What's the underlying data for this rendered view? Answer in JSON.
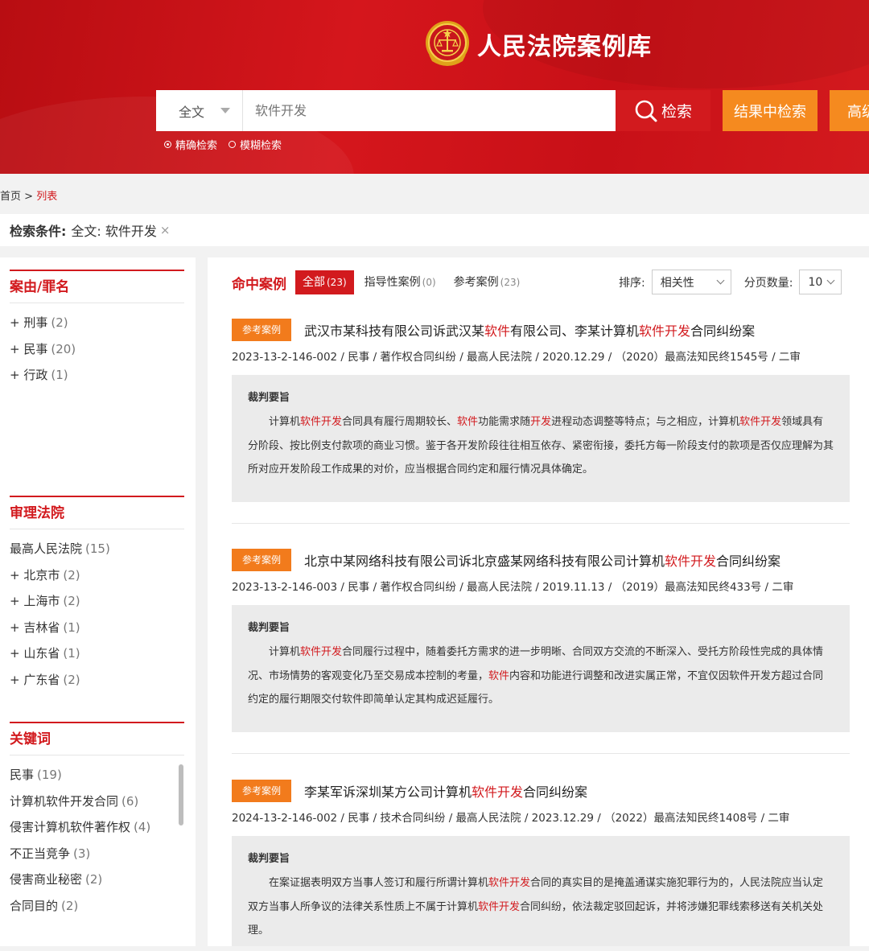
{
  "site": {
    "title": "人民法院案例库"
  },
  "search": {
    "scope": "全文",
    "placeholder": "软件开发",
    "search_label": "检索",
    "refine_label": "结果中检索",
    "advanced_label": "高级检索",
    "modes": [
      "精确检索",
      "模糊检索"
    ]
  },
  "breadcrumb": {
    "home": "首页",
    "sep": ">",
    "current": "列表"
  },
  "conditions": {
    "label": "检索条件:",
    "value": "全文: 软件开发",
    "remove": "×"
  },
  "sidebar": {
    "sections": [
      {
        "title": "案由/罪名",
        "items": [
          {
            "label": "+ 刑事",
            "count": "(2)"
          },
          {
            "label": "+ 民事",
            "count": "(20)"
          },
          {
            "label": "+ 行政",
            "count": "(1)"
          }
        ]
      },
      {
        "title": "审理法院",
        "items": [
          {
            "label": "最高人民法院",
            "count": "(15)"
          },
          {
            "label": "+ 北京市",
            "count": "(2)"
          },
          {
            "label": "+ 上海市",
            "count": "(2)"
          },
          {
            "label": "+ 吉林省",
            "count": "(1)"
          },
          {
            "label": "+ 山东省",
            "count": "(1)"
          },
          {
            "label": "+ 广东省",
            "count": "(2)"
          }
        ]
      },
      {
        "title": "关键词",
        "items": [
          {
            "label": "民事",
            "count": "(19)"
          },
          {
            "label": "计算机软件开发合同",
            "count": "(6)"
          },
          {
            "label": "侵害计算机软件著作权",
            "count": "(4)"
          },
          {
            "label": "不正当竞争",
            "count": "(3)"
          },
          {
            "label": "侵害商业秘密",
            "count": "(2)"
          },
          {
            "label": "合同目的",
            "count": "(2)"
          }
        ]
      }
    ]
  },
  "results": {
    "heading": "命中案例",
    "tabs": [
      {
        "label": "全部",
        "count": "(23)"
      },
      {
        "label": "指导性案例",
        "count": "(0)"
      },
      {
        "label": "参考案例",
        "count": "(23)"
      }
    ],
    "sort_label": "排序:",
    "sort_value": "相关性",
    "page_size_label": "分页数量:",
    "page_size_value": "10",
    "cases": [
      {
        "tag": "参考案例",
        "title": [
          {
            "t": "武汉市某科技有限公司诉武汉某",
            "h": false
          },
          {
            "t": "软件",
            "h": true
          },
          {
            "t": "有限公司、李某计算机",
            "h": false
          },
          {
            "t": "软件开发",
            "h": true
          },
          {
            "t": "合同纠纷案",
            "h": false
          }
        ],
        "meta": "2023-13-2-146-002 / 民事 / 著作权合同纠纷 / 最高人民法院 / 2020.12.29 / （2020）最高法知民终1545号 / 二审",
        "summary_title": "裁判要旨",
        "summary": [
          {
            "t": "计算机",
            "h": false
          },
          {
            "t": "软件开发",
            "h": true
          },
          {
            "t": "合同具有履行周期较长、",
            "h": false
          },
          {
            "t": "软件",
            "h": true
          },
          {
            "t": "功能需求随",
            "h": false
          },
          {
            "t": "开发",
            "h": true
          },
          {
            "t": "进程动态调整等特点；与之相应，计算机",
            "h": false
          },
          {
            "t": "软件开发",
            "h": true
          },
          {
            "t": "领域具有分阶段、按比例支付款项的商业习惯。鉴于各开发阶段往往相互依存、紧密衔接，委托方每一阶段支付的款项是否仅应理解为其所对应开发阶段工作成果的对价，应当根据合同约定和履行情况具体确定。",
            "h": false
          }
        ]
      },
      {
        "tag": "参考案例",
        "title": [
          {
            "t": "北京中某网络科技有限公司诉北京盛某网络科技有限公司计算机",
            "h": false
          },
          {
            "t": "软件开发",
            "h": true
          },
          {
            "t": "合同纠纷案",
            "h": false
          }
        ],
        "meta": "2023-13-2-146-003 / 民事 / 著作权合同纠纷 / 最高人民法院 / 2019.11.13 / （2019）最高法知民终433号 / 二审",
        "summary_title": "裁判要旨",
        "summary": [
          {
            "t": "计算机",
            "h": false
          },
          {
            "t": "软件开发",
            "h": true
          },
          {
            "t": "合同履行过程中，随着委托方需求的进一步明晰、合同双方交流的不断深入、受托方阶段性完成的具体情况、市场情势的客观变化乃至交易成本控制的考量，",
            "h": false
          },
          {
            "t": "软件",
            "h": true
          },
          {
            "t": "内容和功能进行调整和改进实属正常，不宜仅因软件开发方超过合同约定的履行期限交付软件即简单认定其构成迟延履行。",
            "h": false
          }
        ]
      },
      {
        "tag": "参考案例",
        "title": [
          {
            "t": "李某军诉深圳某方公司计算机",
            "h": false
          },
          {
            "t": "软件开发",
            "h": true
          },
          {
            "t": "合同纠纷案",
            "h": false
          }
        ],
        "meta": "2024-13-2-146-002 / 民事 / 技术合同纠纷 / 最高人民法院 / 2023.12.29 / （2022）最高法知民终1408号 / 二审",
        "summary_title": "裁判要旨",
        "summary": [
          {
            "t": "在案证据表明双方当事人签订和履行所谓计算机",
            "h": false
          },
          {
            "t": "软件开发",
            "h": true
          },
          {
            "t": "合同的真实目的是掩盖通谋实施犯罪行为的，人民法院应当认定双方当事人所争议的法律关系性质上不属于计算机",
            "h": false
          },
          {
            "t": "软件开发",
            "h": true
          },
          {
            "t": "合同纠纷，依法裁定驳回起诉，并将涉嫌犯罪线索移送有关机关处理。",
            "h": false
          }
        ]
      }
    ]
  },
  "colors": {
    "brand_red": "#d21a1e",
    "tag_orange": "#f27b1c",
    "button_orange": "#f58a1f"
  }
}
